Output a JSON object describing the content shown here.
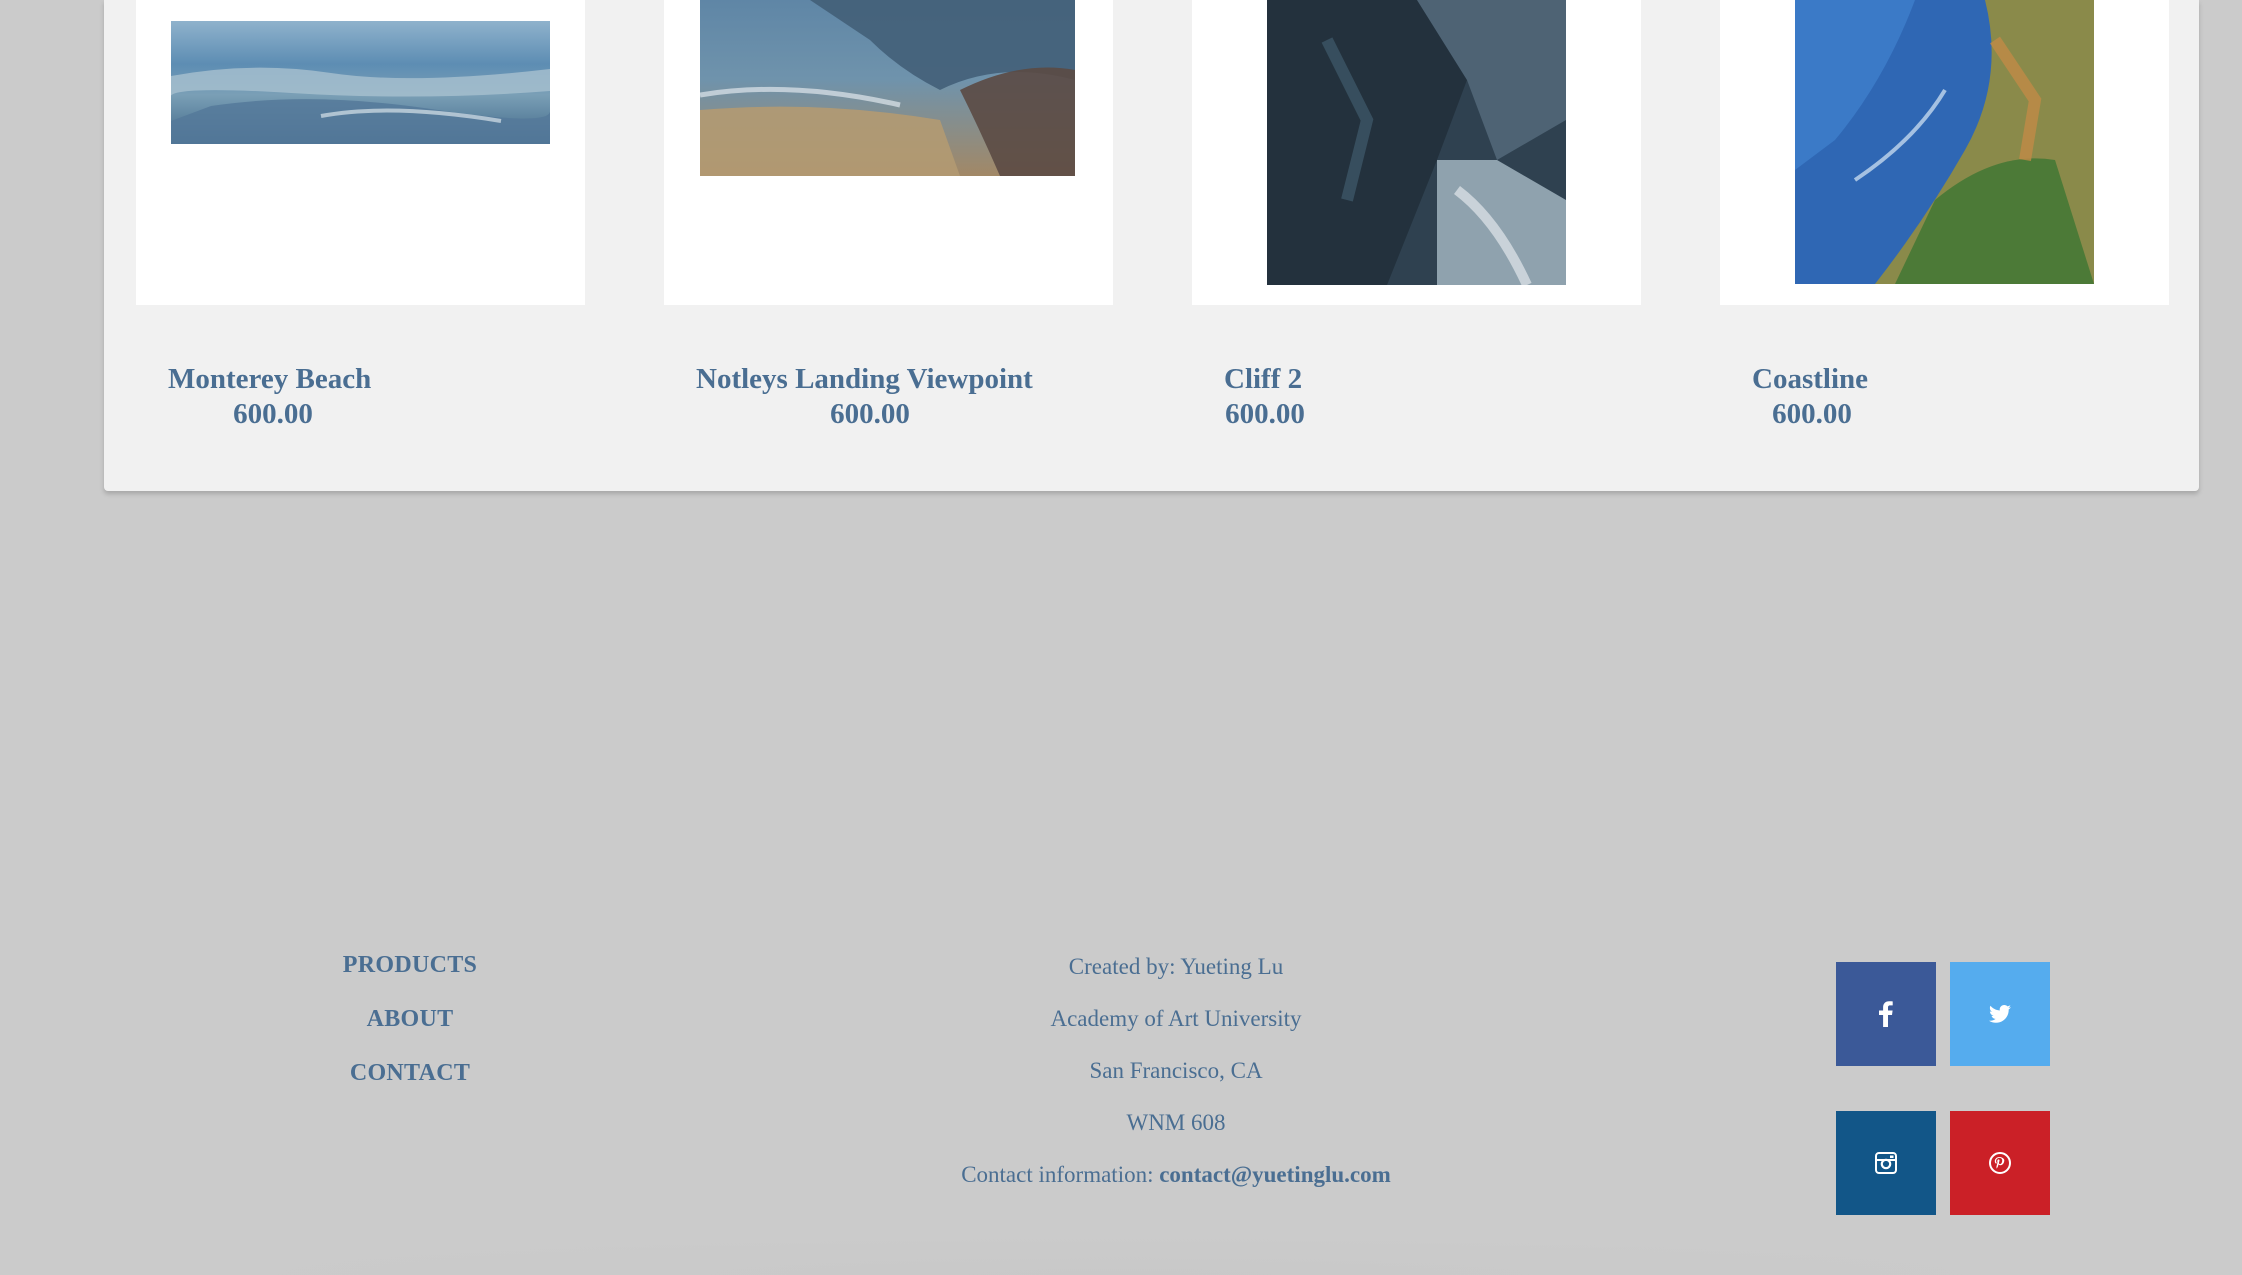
{
  "products": [
    {
      "title": "Monterey Beach",
      "price": "600.00"
    },
    {
      "title": "Notleys Landing Viewpoint",
      "price": "600.00"
    },
    {
      "title": "Cliff 2",
      "price": "600.00"
    },
    {
      "title": "Coastline",
      "price": "600.00"
    }
  ],
  "footer": {
    "nav": {
      "products": "PRODUCTS",
      "about": "ABOUT",
      "contact": "CONTACT"
    },
    "info": {
      "created_by": "Created by: Yueting Lu",
      "school": "Academy of Art University",
      "location": "San Francisco, CA",
      "course": "WNM 608",
      "contact_label": "Contact information:",
      "email": "contact@yuetinglu.com"
    },
    "social": [
      {
        "name": "facebook-icon",
        "color": "#3b5998"
      },
      {
        "name": "twitter-icon",
        "color": "#55acee"
      },
      {
        "name": "instagram-icon",
        "color": "#125688"
      },
      {
        "name": "pinterest-icon",
        "color": "#cb2027"
      }
    ]
  },
  "colors": {
    "link": "#4a6e92",
    "page_bg": "#cbcbcb",
    "panel_bg": "#f1f1f1"
  }
}
